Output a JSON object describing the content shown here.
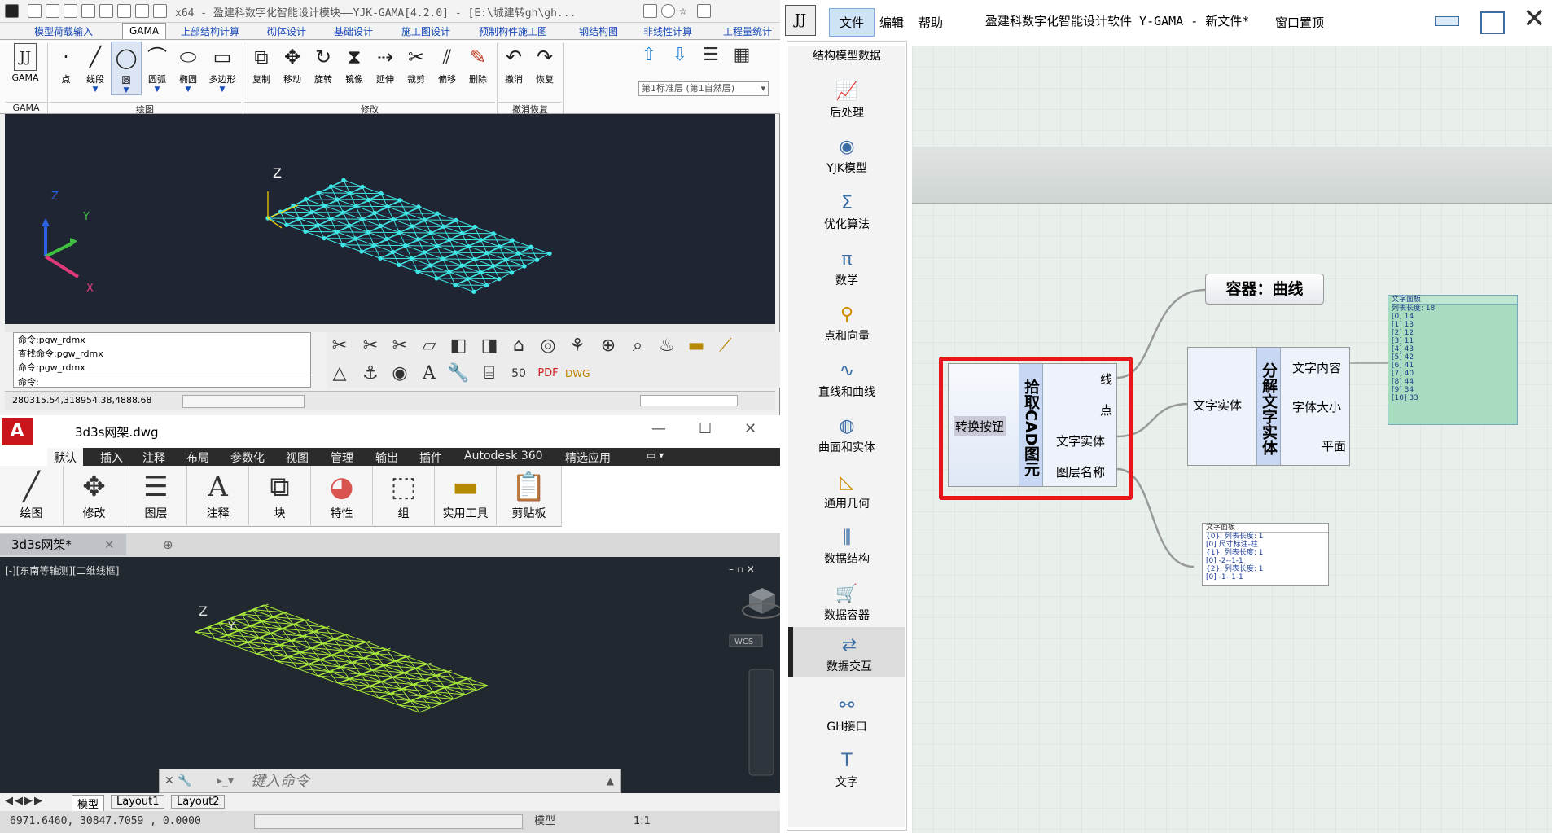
{
  "yjk": {
    "title": "x64 - 盈建科数字化智能设计模块——YJK-GAMA[4.2.0] - [E:\\城建转gh\\gh...",
    "tabs": [
      "模型荷载输入",
      "GAMA",
      "上部结构计算",
      "砌体设计",
      "基础设计",
      "施工图设计",
      "预制构件施工图",
      "钢结构图",
      "非线性计算",
      "工程量统计"
    ],
    "active_tab": "GAMA",
    "ribbon_buttons": [
      {
        "label": "GAMA",
        "icon": "gama-logo-icon",
        "dropdown": false
      },
      {
        "label": "点",
        "icon": "point-icon",
        "dropdown": false
      },
      {
        "label": "线段",
        "icon": "line-icon",
        "dropdown": true
      },
      {
        "label": "圆",
        "icon": "circle-icon",
        "dropdown": true
      },
      {
        "label": "圆弧",
        "icon": "arc-icon",
        "dropdown": true
      },
      {
        "label": "椭圆",
        "icon": "ellipse-icon",
        "dropdown": true
      },
      {
        "label": "多边形",
        "icon": "polygon-icon",
        "dropdown": true
      },
      {
        "label": "复制",
        "icon": "copy-icon",
        "dropdown": false
      },
      {
        "label": "移动",
        "icon": "move-icon",
        "dropdown": false
      },
      {
        "label": "旋转",
        "icon": "rotate-icon",
        "dropdown": false
      },
      {
        "label": "镜像",
        "icon": "mirror-icon",
        "dropdown": false
      },
      {
        "label": "延伸",
        "icon": "extend-icon",
        "dropdown": false
      },
      {
        "label": "裁剪",
        "icon": "trim-icon",
        "dropdown": false
      },
      {
        "label": "偏移",
        "icon": "offset-icon",
        "dropdown": false
      },
      {
        "label": "删除",
        "icon": "delete-icon",
        "dropdown": false
      },
      {
        "label": "撤消",
        "icon": "undo-icon",
        "dropdown": false
      },
      {
        "label": "恢复",
        "icon": "redo-icon",
        "dropdown": false
      }
    ],
    "groups": [
      "GAMA",
      "绘图",
      "修改",
      "撤消恢复"
    ],
    "floor_select": "第1标准层 (第1自然层)",
    "command_lines": [
      "命令:pgw_rdmx",
      "查找命令:pgw_rdmx",
      "命令:pgw_rdmx",
      "命令:"
    ],
    "coordinates": "280315.54,318954.38,4888.68",
    "axis": {
      "z": "Z",
      "y": "Y",
      "x": "X"
    }
  },
  "acad": {
    "title": "3d3s网架.dwg",
    "logo": "A",
    "menu_tabs": [
      "默认",
      "插入",
      "注释",
      "布局",
      "参数化",
      "视图",
      "管理",
      "输出",
      "插件",
      "Autodesk 360",
      "精选应用"
    ],
    "active_menu": "默认",
    "panels": [
      {
        "label": "绘图",
        "icon": "draw-line-icon"
      },
      {
        "label": "修改",
        "icon": "modify-move-icon"
      },
      {
        "label": "图层",
        "icon": "layers-icon"
      },
      {
        "label": "注释",
        "icon": "annotation-icon"
      },
      {
        "label": "块",
        "icon": "block-icon"
      },
      {
        "label": "特性",
        "icon": "properties-wheel-icon"
      },
      {
        "label": "组",
        "icon": "group-icon"
      },
      {
        "label": "实用工具",
        "icon": "measure-icon"
      },
      {
        "label": "剪贴板",
        "icon": "clipboard-icon"
      }
    ],
    "file_tab": "3d3s网架*",
    "viewport_label": "[-][东南等轴测][二维线框]",
    "viewcube_label": "WCS",
    "command_placeholder": "键入命令",
    "layout_tabs": [
      "模型",
      "Layout1",
      "Layout2"
    ],
    "coords": "6971.6460,  30847.7059 , 0.0000",
    "status_model": "模型",
    "status_scale": "1:1",
    "axis": {
      "z": "Z",
      "y": "Y"
    }
  },
  "gh": {
    "menu": [
      "文件",
      "编辑",
      "帮助"
    ],
    "title": "盈建科数字化智能设计软件 Y-GAMA - 新文件*",
    "window_pin": "窗口置顶",
    "sidebar_header": "结构模型数据",
    "sidebar": [
      {
        "label": "后处理",
        "icon": "chart-icon"
      },
      {
        "label": "YJK模型",
        "icon": "yjk-logo-icon"
      },
      {
        "label": "优化算法",
        "icon": "sigma-icon"
      },
      {
        "label": "数学",
        "icon": "pi-icon"
      },
      {
        "label": "点和向量",
        "icon": "point-vector-icon"
      },
      {
        "label": "直线和曲线",
        "icon": "curve-icon"
      },
      {
        "label": "曲面和实体",
        "icon": "surface-icon"
      },
      {
        "label": "通用几何",
        "icon": "triangle-icon"
      },
      {
        "label": "数据结构",
        "icon": "data-structure-icon"
      },
      {
        "label": "数据容器",
        "icon": "cart-icon"
      },
      {
        "label": "数据交互",
        "icon": "data-exchange-icon"
      },
      {
        "label": "GH接口",
        "icon": "gh-interface-icon"
      },
      {
        "label": "文字",
        "icon": "text-icon"
      }
    ],
    "active_sidebar": "数据交互",
    "pick_node": {
      "input": "转换按钮",
      "name": "拾取CAD图元",
      "outputs": [
        "线",
        "点",
        "文字实体",
        "图层名称"
      ]
    },
    "container_node": "容器：曲线",
    "explode_node": {
      "input": "文字实体",
      "name": "分解文字实体",
      "outputs": [
        "文字内容",
        "字体大小",
        "平面"
      ]
    },
    "panel_text": {
      "header": "文字面板",
      "lines": [
        "列表长度: 18",
        "[0] 14",
        "[1] 13",
        "[2] 12",
        "[3] 11",
        "[4] 43",
        "[5] 42",
        "[6] 41",
        "[7] 40",
        "[8] 44",
        "[9] 34",
        "[10] 33"
      ]
    },
    "panel_layers": {
      "header": "文字面板",
      "lines": [
        "{0}, 列表长度: 1",
        "[0] 尺寸标注-柱",
        "{1}, 列表长度: 1",
        "[0] -2--1-1",
        "{2}, 列表长度: 1",
        "[0] -1--1-1"
      ]
    },
    "colors": {
      "highlight": "#e8151b",
      "node_blue": "#c8d8f4",
      "canvas": "#e9f0ec",
      "panel_green": "#a8dcc0"
    }
  }
}
